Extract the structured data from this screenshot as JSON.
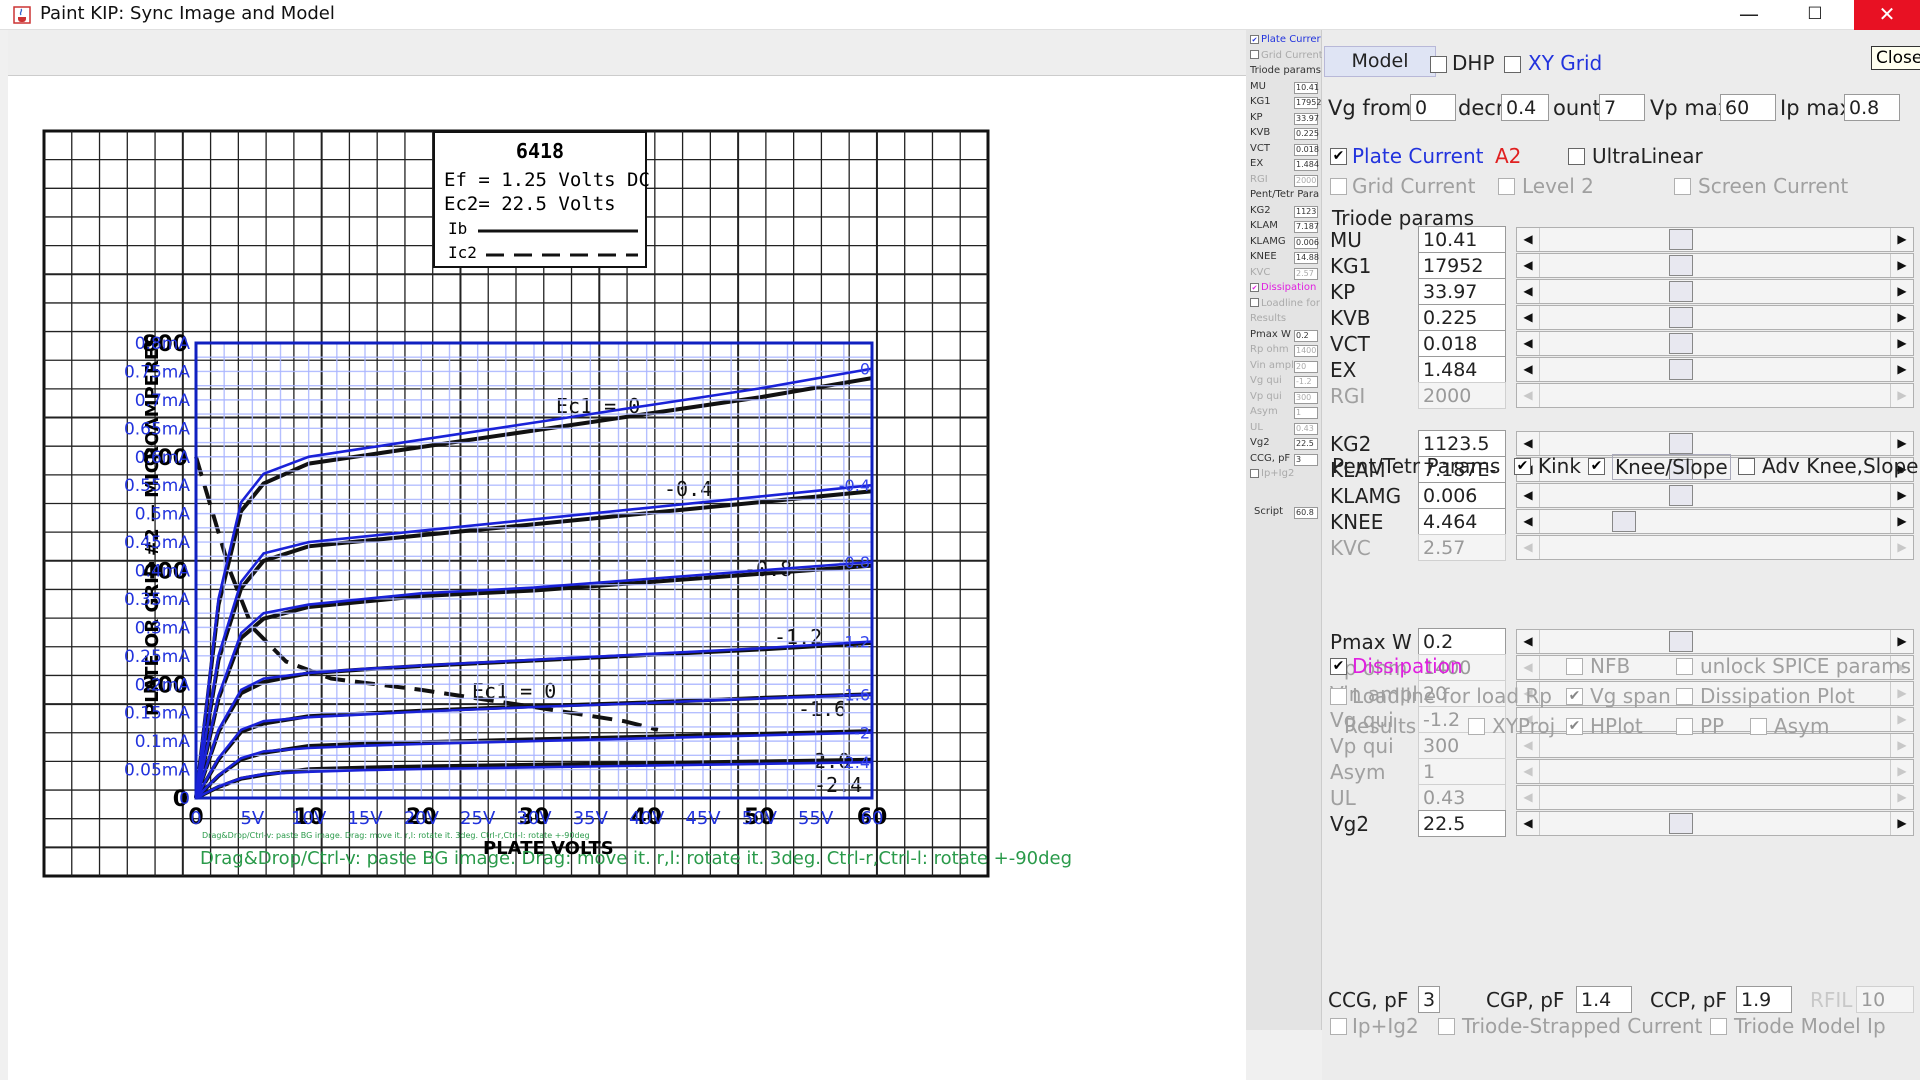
{
  "window": {
    "title": "Paint KIP: Sync Image and Model",
    "min_symbol": "—",
    "max_symbol": "☐",
    "close_symbol": "✕",
    "tooltip": "Close",
    "icon": "java-cup-icon"
  },
  "graph": {
    "scan": {
      "tube": "6418",
      "ef_line": "Ef = 1.25 Volts DC",
      "ec2_line": "Ec2= 22.5 Volts",
      "ib": "Ib",
      "ic2": "Ic2",
      "axis_y_title": "PLATE OR GRID #2 — MICROAMPERES",
      "axis_x_title": "PLATE VOLTS",
      "y_ticks": [
        "0",
        "200",
        "400",
        "600",
        "800"
      ],
      "x_ticks": [
        "0",
        "10",
        "20",
        "30",
        "40",
        "50",
        "60"
      ],
      "curve_labels": [
        "Ec1 = 0",
        "-0.4",
        "-0.8",
        "-1.2",
        "-1.6",
        "-2.0",
        "-2.4",
        "Ec1 = 0"
      ]
    },
    "overlay_y_labels": [
      "0",
      "0.05mA",
      "0.1mA",
      "0.15mA",
      "0.2mA",
      "0.25mA",
      "0.3mA",
      "0.35mA",
      "0.4mA",
      "0.45mA",
      "0.5mA",
      "0.55mA",
      "0.6mA",
      "0.65mA",
      "0.7mA",
      "0.75mA",
      "0.8mA"
    ],
    "overlay_x_labels": [
      "0",
      "5V",
      "10V",
      "15V",
      "20V",
      "25V",
      "30V",
      "35V",
      "40V",
      "45V",
      "50V",
      "55V",
      "60"
    ],
    "curve_grid_labels": [
      "0",
      "-0.4",
      "-0.8",
      "-1.2",
      "-1.6",
      "-2",
      "-2.4"
    ],
    "hint": "Drag&Drop/Ctrl-v: paste BG image. Drag: move it. r,l: rotate it. 3deg. Ctrl-r,Ctrl-l: rotate +-90deg",
    "hint_small": "Drag&Drop/Ctrl-v: paste BG image. Drag: move it. r,l: rotate it. 3deg. Ctrl-r,Ctrl-l: rotate +-90deg"
  },
  "chart_data": {
    "type": "line",
    "xlabel": "PLATE VOLTS",
    "ylabel": "PLATE OR GRID #2 — MICROAMPERES",
    "xlim": [
      0,
      60
    ],
    "ylim": [
      0,
      0.8
    ],
    "grid": true,
    "x": [
      0,
      2,
      4,
      6,
      10,
      15,
      20,
      30,
      40,
      50,
      60
    ],
    "series": [
      {
        "name": "0",
        "values": [
          0,
          0.35,
          0.52,
          0.57,
          0.6,
          0.615,
          0.63,
          0.66,
          0.69,
          0.72,
          0.755
        ]
      },
      {
        "name": "-0.4",
        "values": [
          0,
          0.25,
          0.38,
          0.43,
          0.45,
          0.46,
          0.47,
          0.49,
          0.51,
          0.53,
          0.55
        ]
      },
      {
        "name": "-0.8",
        "values": [
          0,
          0.18,
          0.29,
          0.325,
          0.34,
          0.35,
          0.36,
          0.37,
          0.385,
          0.4,
          0.415
        ]
      },
      {
        "name": "-1.2",
        "values": [
          0,
          0.12,
          0.19,
          0.21,
          0.22,
          0.227,
          0.233,
          0.243,
          0.253,
          0.263,
          0.275
        ]
      },
      {
        "name": "-1.6",
        "values": [
          0,
          0.07,
          0.12,
          0.135,
          0.142,
          0.147,
          0.152,
          0.16,
          0.167,
          0.175,
          0.182
        ]
      },
      {
        "name": "-2",
        "values": [
          0,
          0.04,
          0.07,
          0.082,
          0.088,
          0.092,
          0.095,
          0.1,
          0.105,
          0.11,
          0.115
        ]
      },
      {
        "name": "-2.4",
        "values": [
          0,
          0.02,
          0.035,
          0.042,
          0.046,
          0.049,
          0.051,
          0.054,
          0.057,
          0.06,
          0.063
        ]
      }
    ]
  },
  "mini_panel": {
    "rows": [
      {
        "label": "Plate Currer",
        "cb": true,
        "checked": true,
        "style": "blue"
      },
      {
        "label": "Grid Current",
        "cb": true,
        "checked": false,
        "style": "dis"
      },
      {
        "label": "Triode params",
        "style": ""
      },
      {
        "label": "MU",
        "val": "10.41"
      },
      {
        "label": "KG1",
        "val": "17952"
      },
      {
        "label": "KP",
        "val": "33.97"
      },
      {
        "label": "KVB",
        "val": "0.225"
      },
      {
        "label": "VCT",
        "val": "0.018"
      },
      {
        "label": "EX",
        "val": "1.484"
      },
      {
        "label": "RGI",
        "val": "2000",
        "style": "dis"
      },
      {
        "label": "Pent/Tetr Para",
        "style": ""
      },
      {
        "label": "KG2",
        "val": "1123"
      },
      {
        "label": "KLAM",
        "val": "7.187"
      },
      {
        "label": "KLAMG",
        "val": "0.006"
      },
      {
        "label": "KNEE",
        "val": "14.88"
      },
      {
        "label": "KVC",
        "val": "2.57",
        "style": "dis"
      },
      {
        "label": "Dissipation",
        "cb": true,
        "checked": true,
        "style": "mag"
      },
      {
        "label": "Loadline for",
        "cb": true,
        "checked": false,
        "style": "dis"
      },
      {
        "label": "Results",
        "style": "dis"
      },
      {
        "label": "Pmax W",
        "val": "0.2"
      },
      {
        "label": "Rp ohm",
        "val": "1400",
        "style": "dis"
      },
      {
        "label": "Vin ampl",
        "val": "20",
        "style": "dis"
      },
      {
        "label": "Vg qui",
        "val": "-1.2",
        "style": "dis"
      },
      {
        "label": "Vp qui",
        "val": "300",
        "style": "dis"
      },
      {
        "label": "Asym",
        "val": "1",
        "style": "dis"
      },
      {
        "label": "UL",
        "val": "0.43",
        "style": "dis"
      },
      {
        "label": "Vg2",
        "val": "22.5"
      },
      {
        "label": "CCG, pF",
        "val": "3"
      },
      {
        "label": "Ip+Ig2",
        "cb": true,
        "checked": false,
        "style": "dis"
      }
    ],
    "script_label": "Script",
    "script_val": "60.8"
  },
  "controls": {
    "model_button": "Model",
    "dhp": "DHP",
    "xy_grid": "XY Grid",
    "vg_from_label": "Vg from",
    "vg_from": "0",
    "decr_label": "decr",
    "decr": "0.4",
    "count_label": "ount",
    "count": "7",
    "vp_max_label": "Vp max",
    "vp_max": "60",
    "ip_max_label": "Ip max",
    "ip_max": "0.8",
    "plate_current": "Plate Current",
    "a2": "A2",
    "ultralinear": "UltraLinear",
    "grid_current": "Grid Current",
    "level2": "Level 2",
    "screen_current": "Screen Current",
    "triode_params": "Triode params",
    "pent_params": "Pent/Tetr Params",
    "kink": "Kink",
    "knee_slope": "Knee/Slope",
    "adv_knee": "Adv Knee,Slope",
    "dissipation": "Dissipation",
    "nfb": "NFB",
    "unlock_spice": "unlock SPICE params",
    "loadline": "Loadline for load Rp",
    "vg_span": "Vg span",
    "dissipation_plot": "Dissipation Plot",
    "results": "Results",
    "xyproj": "XYProj",
    "hplot": "HPlot",
    "pp": "PP",
    "asym_cb": "Asym",
    "ccg_label": "CCG, pF",
    "ccg": "3",
    "cgp_label": "CGP, pF",
    "cgp": "1.4",
    "ccp_label": "CCP, pF",
    "ccp": "1.9",
    "rfil_label": "RFIL",
    "rfil": "10",
    "ip_ig2": "Ip+Ig2",
    "triode_strapped": "Triode-Strapped Current",
    "triode_model_ip": "Triode Model Ip",
    "left_arrow": "◀",
    "right_arrow": "▶",
    "params": [
      {
        "label": "MU",
        "value": "10.41",
        "pos": 0.4,
        "disabled": false
      },
      {
        "label": "KG1",
        "value": "17952",
        "pos": 0.4,
        "disabled": false
      },
      {
        "label": "KP",
        "value": "33.97",
        "pos": 0.4,
        "disabled": false
      },
      {
        "label": "KVB",
        "value": "0.225",
        "pos": 0.4,
        "disabled": false
      },
      {
        "label": "VCT",
        "value": "0.018",
        "pos": 0.4,
        "disabled": false
      },
      {
        "label": "EX",
        "value": "1.484",
        "pos": 0.4,
        "disabled": false
      },
      {
        "label": "RGI",
        "value": "2000",
        "pos": null,
        "disabled": true
      },
      {
        "label": "KG2",
        "value": "1123.5",
        "pos": 0.4,
        "disabled": false
      },
      {
        "label": "KLAM",
        "value": "7.187E-9",
        "pos": 0.4,
        "disabled": false
      },
      {
        "label": "KLAMG",
        "value": "0.006",
        "pos": 0.4,
        "disabled": false
      },
      {
        "label": "KNEE",
        "value": "4.464",
        "pos": 0.24,
        "disabled": false
      },
      {
        "label": "KVC",
        "value": "2.57",
        "pos": null,
        "disabled": true
      },
      {
        "label": "Pmax W",
        "value": "0.2",
        "pos": 0.4,
        "disabled": false
      },
      {
        "label": "Rp ohm",
        "value": "1400",
        "pos": null,
        "disabled": true
      },
      {
        "label": "Vin ampl",
        "value": "20",
        "pos": null,
        "disabled": true
      },
      {
        "label": "Vg qui",
        "value": "-1.2",
        "pos": null,
        "disabled": true
      },
      {
        "label": "Vp qui",
        "value": "300",
        "pos": null,
        "disabled": true
      },
      {
        "label": "Asym",
        "value": "1",
        "pos": null,
        "disabled": true
      },
      {
        "label": "UL",
        "value": "0.43",
        "pos": null,
        "disabled": true
      },
      {
        "label": "Vg2",
        "value": "22.5",
        "pos": 0.4,
        "disabled": false
      }
    ]
  }
}
